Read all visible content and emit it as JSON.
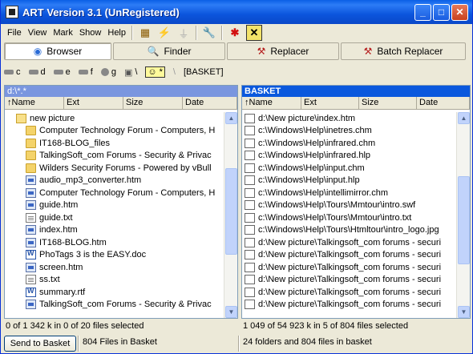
{
  "window": {
    "title": "ART Version 3.1 (UnRegistered)"
  },
  "menu": [
    "File",
    "View",
    "Mark",
    "Show",
    "Help"
  ],
  "toolbar_icons": [
    "grid-icon",
    "bolt-icon",
    "plug-icon",
    "wrench-icon",
    "asterisk-icon",
    "x-box-icon"
  ],
  "tabs": [
    {
      "label": "Browser",
      "icon": "globe-icon"
    },
    {
      "label": "Finder",
      "icon": "magnifier-icon"
    },
    {
      "label": "Replacer",
      "icon": "hammer-icon"
    },
    {
      "label": "Batch Replacer",
      "icon": "hammer-icon"
    }
  ],
  "drives": [
    "c",
    "d",
    "e",
    "f",
    "g",
    "\\",
    "*",
    "\\",
    "[BASKET]"
  ],
  "left": {
    "title": "d:\\*.*",
    "columns": [
      "↑Name",
      "Ext",
      "Size",
      "Date"
    ],
    "rows": [
      {
        "icon": "folder-open",
        "name": "new picture"
      },
      {
        "icon": "folder",
        "name": "Computer Technology Forum - Computers, H"
      },
      {
        "icon": "folder",
        "name": "IT168-BLOG_files"
      },
      {
        "icon": "folder",
        "name": "TalkingSoft_com Forums - Security & Privac"
      },
      {
        "icon": "folder",
        "name": "Wilders Security Forums - Powered by vBull"
      },
      {
        "icon": "htm",
        "name": "audio_mp3_converter.htm"
      },
      {
        "icon": "htm",
        "name": "Computer Technology Forum - Computers, H"
      },
      {
        "icon": "htm",
        "name": "guide.htm"
      },
      {
        "icon": "txt",
        "name": "guide.txt"
      },
      {
        "icon": "htm",
        "name": "index.htm"
      },
      {
        "icon": "htm",
        "name": "IT168-BLOG.htm"
      },
      {
        "icon": "doc",
        "name": "PhoTags 3 is the EASY.doc"
      },
      {
        "icon": "htm",
        "name": "screen.htm"
      },
      {
        "icon": "txt",
        "name": "ss.txt"
      },
      {
        "icon": "doc",
        "name": "summary.rtf"
      },
      {
        "icon": "htm",
        "name": "TalkingSoft_com Forums - Security & Privac"
      }
    ],
    "status": "0 of 1 342 k in 0 of 20 files selected"
  },
  "right": {
    "title": "BASKET",
    "columns": [
      "↑Name",
      "Ext",
      "Size",
      "Date"
    ],
    "rows": [
      "d:\\New picture\\index.htm",
      "c:\\Windows\\Help\\inetres.chm",
      "c:\\Windows\\Help\\infrared.chm",
      "c:\\Windows\\Help\\infrared.hlp",
      "c:\\Windows\\Help\\input.chm",
      "c:\\Windows\\Help\\input.hlp",
      "c:\\Windows\\Help\\intellimirror.chm",
      "c:\\Windows\\Help\\Tours\\Mmtour\\intro.swf",
      "c:\\Windows\\Help\\Tours\\Mmtour\\intro.txt",
      "c:\\Windows\\Help\\Tours\\Htmltour\\intro_logo.jpg",
      "d:\\New picture\\Talkingsoft_com forums - securi",
      "d:\\New picture\\Talkingsoft_com forums - securi",
      "d:\\New picture\\Talkingsoft_com forums - securi",
      "d:\\New picture\\Talkingsoft_com forums - securi",
      "d:\\New picture\\Talkingsoft_com forums - securi",
      "d:\\New picture\\Talkingsoft_com forums - securi"
    ],
    "status": "1 049 of 54 923 k in 5 of 804 files selected"
  },
  "bottom": {
    "send_button": "Send to Basket",
    "files_in_basket": "804 Files in Basket",
    "summary": "24 folders and 804 files in basket"
  }
}
